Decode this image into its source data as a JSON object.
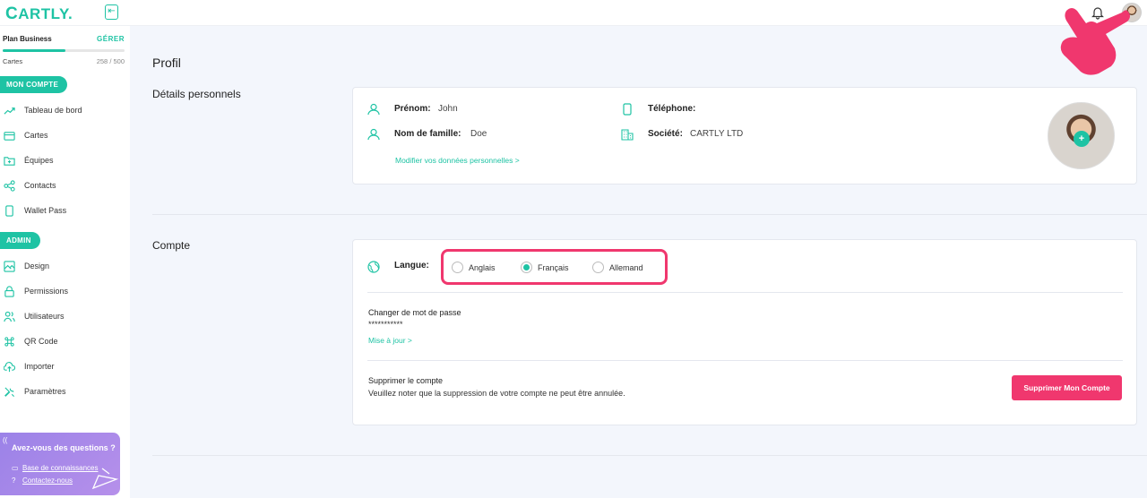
{
  "app": {
    "logo": "CARTLY.",
    "logo_first": "C",
    "logo_rest": "ARTLY."
  },
  "colors": {
    "brand": "#1ec3a4",
    "danger": "#f0376e",
    "help_bg": "#a78ae9"
  },
  "topbar": {
    "collapse_icon": "arrow-left-icon",
    "bell_icon": "bell-icon"
  },
  "plan": {
    "name": "Plan Business",
    "manage_label": "GÉRER",
    "cards_label": "Cartes",
    "cards_count": "258 / 500",
    "usage_fraction": 0.516
  },
  "sidebar": {
    "section_account": "MON COMPTE",
    "account_items": [
      {
        "label": "Tableau de bord",
        "icon": "trend-icon"
      },
      {
        "label": "Cartes",
        "icon": "card-icon"
      },
      {
        "label": "Équipes",
        "icon": "team-icon"
      },
      {
        "label": "Contacts",
        "icon": "share-icon"
      },
      {
        "label": "Wallet Pass",
        "icon": "phone-icon"
      }
    ],
    "section_admin": "ADMIN",
    "admin_items": [
      {
        "label": "Design",
        "icon": "image-icon"
      },
      {
        "label": "Permissions",
        "icon": "lock-icon"
      },
      {
        "label": "Utilisateurs",
        "icon": "users-icon"
      },
      {
        "label": "QR Code",
        "icon": "command-icon"
      },
      {
        "label": "Importer",
        "icon": "upload-icon"
      },
      {
        "label": "Paramètres",
        "icon": "tools-icon"
      }
    ]
  },
  "help": {
    "title": "Avez-vous des questions ?",
    "kb_link": "Base de connaissances",
    "contact_link": "Contactez-nous"
  },
  "page": {
    "title": "Profil"
  },
  "personal": {
    "section": "Détails personnels",
    "first_name_label": "Prénom:",
    "first_name": "John",
    "last_name_label": "Nom de famille:",
    "last_name": "Doe",
    "phone_label": "Téléphone:",
    "phone": "",
    "company_label": "Société:",
    "company": "CARTLY LTD",
    "edit_link": "Modifier vos données personnelles >"
  },
  "account": {
    "section": "Compte",
    "language_label": "Langue:",
    "languages": [
      "Anglais",
      "Français",
      "Allemand"
    ],
    "selected_language": "Français",
    "password_title": "Changer de mot de passe",
    "password_value": "***********",
    "password_link": "Mise à jour >",
    "delete_title": "Supprimer le compte",
    "delete_note": "Veuillez noter que la suppression de votre compte ne peut être annulée.",
    "delete_button": "Supprimer Mon Compte"
  }
}
